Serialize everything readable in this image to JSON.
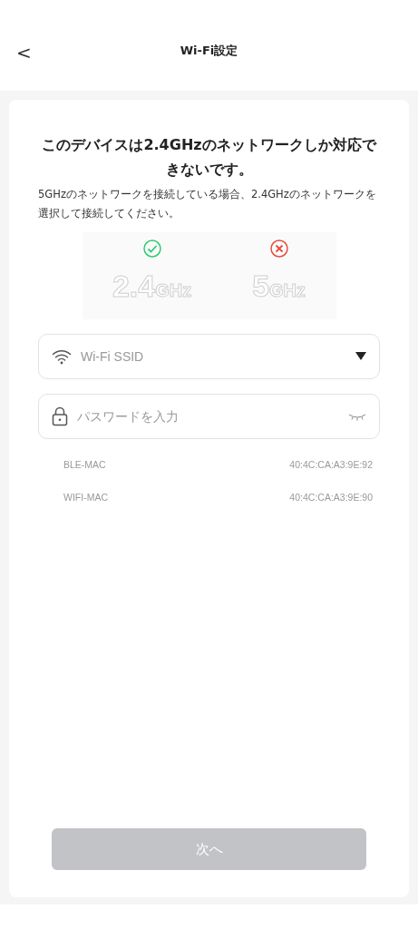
{
  "header": {
    "back": "<",
    "title": "Wi-Fi設定"
  },
  "notice": {
    "title": "このデバイスは2.4GHzのネットワークしか対応できないです。",
    "body": "5GHzのネットワークを接続している場合、2.4GHzのネットワークを選択して接続してください。"
  },
  "bands": [
    {
      "number": "2.4",
      "unit": "GHz",
      "supported": true
    },
    {
      "number": "5",
      "unit": "GHz",
      "supported": false
    }
  ],
  "ssid_field": {
    "placeholder": "Wi-Fi SSID"
  },
  "password_field": {
    "placeholder": "パスワードを入力"
  },
  "info": [
    {
      "label": "BLE-MAC",
      "value": "40:4C:CA:A3:9E:92"
    },
    {
      "label": "WIFI-MAC",
      "value": "40:4C:CA:A3:9E:90"
    }
  ],
  "next_button": {
    "label": "次へ",
    "disabled": true
  }
}
